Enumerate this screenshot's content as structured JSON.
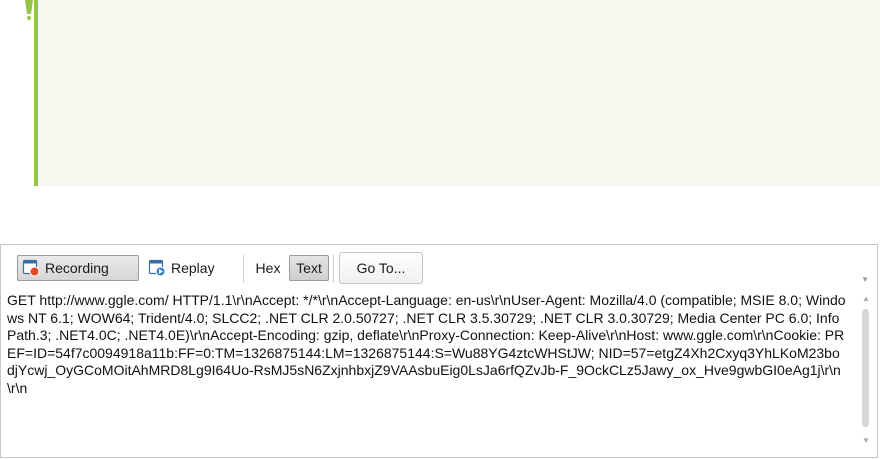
{
  "toolbar": {
    "recording_label": "Recording",
    "replay_label": "Replay",
    "hex_label": "Hex",
    "text_label": "Text",
    "goto_label": "Go To..."
  },
  "icons": {
    "recording": "record-icon",
    "replay": "replay-icon"
  },
  "content": {
    "text": "GET http://www.ggle.com/ HTTP/1.1\\r\\nAccept: */*\\r\\nAccept-Language: en-us\\r\\nUser-Agent: Mozilla/4.0 (compatible; MSIE 8.0; Windows NT 6.1; WOW64; Trident/4.0; SLCC2; .NET CLR 2.0.50727; .NET CLR 3.5.30729; .NET CLR 3.0.30729; Media Center PC 6.0; InfoPath.3; .NET4.0C; .NET4.0E)\\r\\nAccept-Encoding: gzip, deflate\\r\\nProxy-Connection: Keep-Alive\\r\\nHost: www.ggle.com\\r\\nCookie: PREF=ID=54f7c0094918a11b:FF=0:TM=1326875144:LM=1326875144:S=Wu88YG4ztcWHStJW; NID=57=etgZ4Xh2Cxyq3YhLKoM23bodjYcwj_OyGCoMOitAhMRD8Lg9I64Uo-RsMJ5sN6ZxjnhbxjZ9VAAsbuEig0LsJa6rfQZvJb-F_9OckCLz5Jawy_ox_Hve9gwbGI0eAg1j\\r\\n\\r\\n"
  },
  "colors": {
    "note_border": "#94c548",
    "note_background": "#f4f8ef",
    "panel_border": "#c6c6c6"
  }
}
